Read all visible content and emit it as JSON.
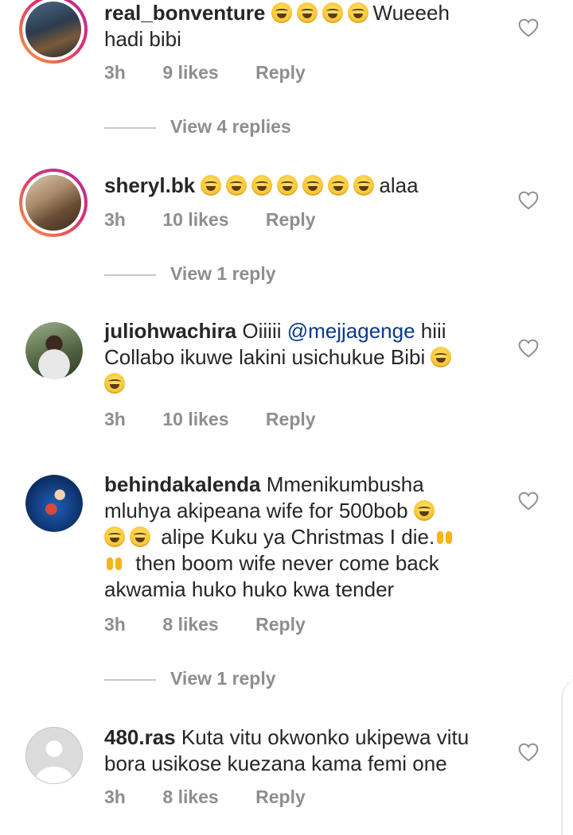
{
  "comments": [
    {
      "username": "real_bonventure",
      "text_before": "",
      "emoji_after_user": 4,
      "text": "Wueeeh hadi bibi",
      "time": "3h",
      "likes": "9 likes",
      "reply": "Reply",
      "view_replies": "View 4 replies"
    },
    {
      "username": "sheryl.bk",
      "emoji_after_user": 7,
      "text": "alaa",
      "time": "3h",
      "likes": "10 likes",
      "reply": "Reply",
      "view_replies": "View 1 reply"
    },
    {
      "username": "juliohwachira",
      "text_a": "Oiiiii",
      "mention": "@mejjagenge",
      "text_b": "hiii Collabo ikuwe lakini usichukue Bibi",
      "time": "3h",
      "likes": "10 likes",
      "reply": "Reply"
    },
    {
      "username": "behindakalenda",
      "text_a": "Mmenikumbusha mluhya akipeana wife for 500bob",
      "text_b": "alipe Kuku ya Christmas I die.",
      "text_c": "then boom wife never come back akwamia huko huko kwa tender",
      "time": "3h",
      "likes": "8 likes",
      "reply": "Reply",
      "view_replies": "View 1 reply"
    },
    {
      "username": "480.ras",
      "text": "Kuta vitu okwonko ukipewa vitu bora usikose kuezana kama femi one",
      "time": "3h",
      "likes": "8 likes",
      "reply": "Reply"
    }
  ],
  "colors": {
    "text": "#262626",
    "meta": "#8e8e8e",
    "mention": "#0a3a8a",
    "story_ring": "#e1306c"
  },
  "icons": {
    "like": "heart-outline-icon",
    "laugh": "face-with-tears-of-joy-emoji",
    "raised_hands": "raising-hands-emoji"
  }
}
